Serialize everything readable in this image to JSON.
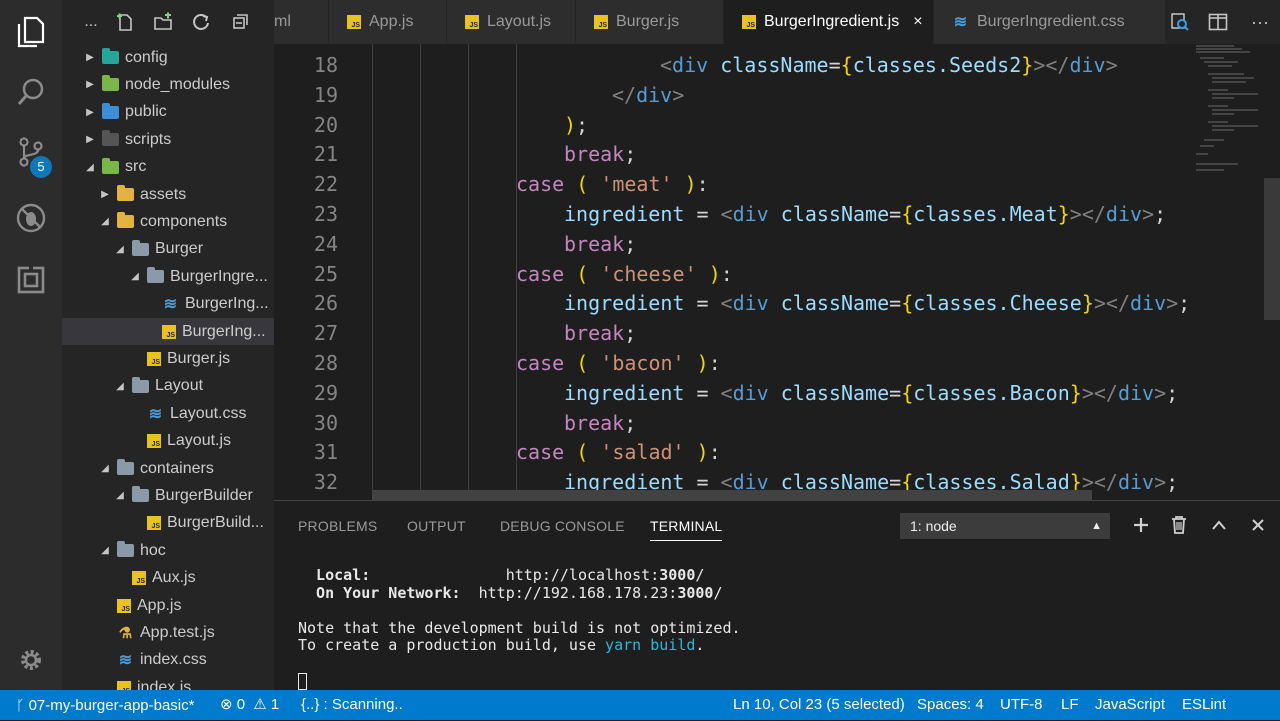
{
  "activity": {
    "source_control_badge": "5",
    "icons": [
      "explorer-icon",
      "search-icon",
      "source-control-icon",
      "debug-icon",
      "extensions-icon",
      "settings-gear-icon"
    ]
  },
  "explorer": {
    "more_label": "...",
    "items": [
      {
        "label": "config",
        "depth": 0,
        "type": "folder",
        "open": false,
        "color": "teal"
      },
      {
        "label": "node_modules",
        "depth": 0,
        "type": "folder",
        "open": false,
        "color": "green"
      },
      {
        "label": "public",
        "depth": 0,
        "type": "folder",
        "open": false,
        "color": "blue"
      },
      {
        "label": "scripts",
        "depth": 0,
        "type": "folder",
        "open": false,
        "color": "dark"
      },
      {
        "label": "src",
        "depth": 0,
        "type": "folder",
        "open": true,
        "color": "green"
      },
      {
        "label": "assets",
        "depth": 1,
        "type": "folder",
        "open": false,
        "color": "yellow"
      },
      {
        "label": "components",
        "depth": 1,
        "type": "folder",
        "open": true,
        "color": "yellow"
      },
      {
        "label": "Burger",
        "depth": 2,
        "type": "folder",
        "open": true,
        "color": "grey"
      },
      {
        "label": "BurgerIngre...",
        "depth": 3,
        "type": "folder",
        "open": true,
        "color": "grey"
      },
      {
        "label": "BurgerIng...",
        "depth": 4,
        "type": "css"
      },
      {
        "label": "BurgerIng...",
        "depth": 4,
        "type": "js",
        "selected": true
      },
      {
        "label": "Burger.js",
        "depth": 3,
        "type": "js"
      },
      {
        "label": "Layout",
        "depth": 2,
        "type": "folder",
        "open": true,
        "color": "grey"
      },
      {
        "label": "Layout.css",
        "depth": 3,
        "type": "css"
      },
      {
        "label": "Layout.js",
        "depth": 3,
        "type": "js"
      },
      {
        "label": "containers",
        "depth": 1,
        "type": "folder",
        "open": true,
        "color": "grey"
      },
      {
        "label": "BurgerBuilder",
        "depth": 2,
        "type": "folder",
        "open": true,
        "color": "grey"
      },
      {
        "label": "BurgerBuild...",
        "depth": 3,
        "type": "js"
      },
      {
        "label": "hoc",
        "depth": 1,
        "type": "folder",
        "open": true,
        "color": "grey"
      },
      {
        "label": "Aux.js",
        "depth": 2,
        "type": "js"
      },
      {
        "label": "App.js",
        "depth": 1,
        "type": "js"
      },
      {
        "label": "App.test.js",
        "depth": 1,
        "type": "test"
      },
      {
        "label": "index.css",
        "depth": 1,
        "type": "css"
      },
      {
        "label": "index.js",
        "depth": 1,
        "type": "js"
      }
    ]
  },
  "tabs": [
    {
      "label": "ml",
      "type": "none"
    },
    {
      "label": "App.js",
      "type": "js"
    },
    {
      "label": "Layout.js",
      "type": "js"
    },
    {
      "label": "Burger.js",
      "type": "js"
    },
    {
      "label": "BurgerIngredient.js",
      "type": "js",
      "active": true,
      "close": "×"
    },
    {
      "label": "BurgerIngredient.css",
      "type": "css"
    }
  ],
  "editor": {
    "lines": [
      {
        "n": "18",
        "indent": 24,
        "tokens": [
          [
            "t-punct",
            "<"
          ],
          [
            "t-tag",
            "div"
          ],
          [
            "t-plain",
            " "
          ],
          [
            "t-attr",
            "className"
          ],
          [
            "t-plain",
            "="
          ],
          [
            "t-brace",
            "{"
          ],
          [
            "t-attr",
            "classes.Seeds2"
          ],
          [
            "t-brace",
            "}"
          ],
          [
            "t-punct",
            "></"
          ],
          [
            "t-tag",
            "div"
          ],
          [
            "t-punct",
            ">"
          ]
        ]
      },
      {
        "n": "19",
        "indent": 20,
        "tokens": [
          [
            "t-punct",
            "</"
          ],
          [
            "t-tag",
            "div"
          ],
          [
            "t-punct",
            ">"
          ]
        ]
      },
      {
        "n": "20",
        "indent": 16,
        "tokens": [
          [
            "t-brace",
            ")"
          ],
          [
            "t-plain",
            ";"
          ]
        ]
      },
      {
        "n": "21",
        "indent": 16,
        "tokens": [
          [
            "t-kw",
            "break"
          ],
          [
            "t-plain",
            ";"
          ]
        ]
      },
      {
        "n": "22",
        "indent": 12,
        "tokens": [
          [
            "t-kw",
            "case"
          ],
          [
            "t-plain",
            " "
          ],
          [
            "t-brace",
            "("
          ],
          [
            "t-plain",
            " "
          ],
          [
            "t-str",
            "'meat'"
          ],
          [
            "t-plain",
            " "
          ],
          [
            "t-brace",
            ")"
          ],
          [
            "t-plain",
            ":"
          ]
        ]
      },
      {
        "n": "23",
        "indent": 16,
        "tokens": [
          [
            "t-attr",
            "ingredient"
          ],
          [
            "t-plain",
            " = "
          ],
          [
            "t-punct",
            "<"
          ],
          [
            "t-tag",
            "div"
          ],
          [
            "t-plain",
            " "
          ],
          [
            "t-attr",
            "className"
          ],
          [
            "t-plain",
            "="
          ],
          [
            "t-brace",
            "{"
          ],
          [
            "t-attr",
            "classes.Meat"
          ],
          [
            "t-brace",
            "}"
          ],
          [
            "t-punct",
            "></"
          ],
          [
            "t-tag",
            "div"
          ],
          [
            "t-punct",
            ">"
          ],
          [
            "t-plain",
            ";"
          ]
        ]
      },
      {
        "n": "24",
        "indent": 16,
        "tokens": [
          [
            "t-kw",
            "break"
          ],
          [
            "t-plain",
            ";"
          ]
        ]
      },
      {
        "n": "25",
        "indent": 12,
        "tokens": [
          [
            "t-kw",
            "case"
          ],
          [
            "t-plain",
            " "
          ],
          [
            "t-brace",
            "("
          ],
          [
            "t-plain",
            " "
          ],
          [
            "t-str",
            "'cheese'"
          ],
          [
            "t-plain",
            " "
          ],
          [
            "t-brace",
            ")"
          ],
          [
            "t-plain",
            ":"
          ]
        ]
      },
      {
        "n": "26",
        "indent": 16,
        "tokens": [
          [
            "t-attr",
            "ingredient"
          ],
          [
            "t-plain",
            " = "
          ],
          [
            "t-punct",
            "<"
          ],
          [
            "t-tag",
            "div"
          ],
          [
            "t-plain",
            " "
          ],
          [
            "t-attr",
            "className"
          ],
          [
            "t-plain",
            "="
          ],
          [
            "t-brace",
            "{"
          ],
          [
            "t-attr",
            "classes.Cheese"
          ],
          [
            "t-brace",
            "}"
          ],
          [
            "t-punct",
            "></"
          ],
          [
            "t-tag",
            "div"
          ],
          [
            "t-punct",
            ">"
          ],
          [
            "t-plain",
            ";"
          ]
        ]
      },
      {
        "n": "27",
        "indent": 16,
        "tokens": [
          [
            "t-kw",
            "break"
          ],
          [
            "t-plain",
            ";"
          ]
        ]
      },
      {
        "n": "28",
        "indent": 12,
        "tokens": [
          [
            "t-kw",
            "case"
          ],
          [
            "t-plain",
            " "
          ],
          [
            "t-brace",
            "("
          ],
          [
            "t-plain",
            " "
          ],
          [
            "t-str",
            "'bacon'"
          ],
          [
            "t-plain",
            " "
          ],
          [
            "t-brace",
            ")"
          ],
          [
            "t-plain",
            ":"
          ]
        ]
      },
      {
        "n": "29",
        "indent": 16,
        "tokens": [
          [
            "t-attr",
            "ingredient"
          ],
          [
            "t-plain",
            " = "
          ],
          [
            "t-punct",
            "<"
          ],
          [
            "t-tag",
            "div"
          ],
          [
            "t-plain",
            " "
          ],
          [
            "t-attr",
            "className"
          ],
          [
            "t-plain",
            "="
          ],
          [
            "t-brace",
            "{"
          ],
          [
            "t-attr",
            "classes.Bacon"
          ],
          [
            "t-brace",
            "}"
          ],
          [
            "t-punct",
            "></"
          ],
          [
            "t-tag",
            "div"
          ],
          [
            "t-punct",
            ">"
          ],
          [
            "t-plain",
            ";"
          ]
        ]
      },
      {
        "n": "30",
        "indent": 16,
        "tokens": [
          [
            "t-kw",
            "break"
          ],
          [
            "t-plain",
            ";"
          ]
        ]
      },
      {
        "n": "31",
        "indent": 12,
        "tokens": [
          [
            "t-kw",
            "case"
          ],
          [
            "t-plain",
            " "
          ],
          [
            "t-brace",
            "("
          ],
          [
            "t-plain",
            " "
          ],
          [
            "t-str",
            "'salad'"
          ],
          [
            "t-plain",
            " "
          ],
          [
            "t-brace",
            ")"
          ],
          [
            "t-plain",
            ":"
          ]
        ]
      },
      {
        "n": "32",
        "indent": 16,
        "tokens": [
          [
            "t-attr",
            "ingredient"
          ],
          [
            "t-plain",
            " = "
          ],
          [
            "t-punct",
            "<"
          ],
          [
            "t-tag",
            "div"
          ],
          [
            "t-plain",
            " "
          ],
          [
            "t-attr",
            "className"
          ],
          [
            "t-plain",
            "="
          ],
          [
            "t-brace",
            "{"
          ],
          [
            "t-attr",
            "classes.Salad"
          ],
          [
            "t-brace",
            "}"
          ],
          [
            "t-punct",
            "></"
          ],
          [
            "t-tag",
            "div"
          ],
          [
            "t-punct",
            ">"
          ],
          [
            "t-plain",
            ";"
          ]
        ]
      }
    ]
  },
  "panel": {
    "tabs": [
      "PROBLEMS",
      "OUTPUT",
      "DEBUG CONSOLE",
      "TERMINAL"
    ],
    "active_tab": "TERMINAL",
    "terminal_select": "1: node",
    "terminal": {
      "local_label": "  Local:",
      "local_url_prefix": "http://localhost:",
      "local_port": "3000",
      "local_url_suffix": "/",
      "network_label": "  On Your Network:",
      "network_url_prefix": "http://192.168.178.23:",
      "network_port": "3000",
      "network_url_suffix": "/",
      "note": "Note that the development build is not optimized.",
      "build_prefix": "To create a production build, use ",
      "build_cmd": "yarn build",
      "build_suffix": "."
    }
  },
  "status": {
    "branch": "07-my-burger-app-basic*",
    "errors": "0",
    "warnings": "1",
    "scanning": "{..} : Scanning..",
    "position": "Ln 10, Col 23 (5 selected)",
    "spaces": "Spaces: 4",
    "encoding": "UTF-8",
    "eol": "LF",
    "language": "JavaScript",
    "eslint": "ESLint"
  }
}
